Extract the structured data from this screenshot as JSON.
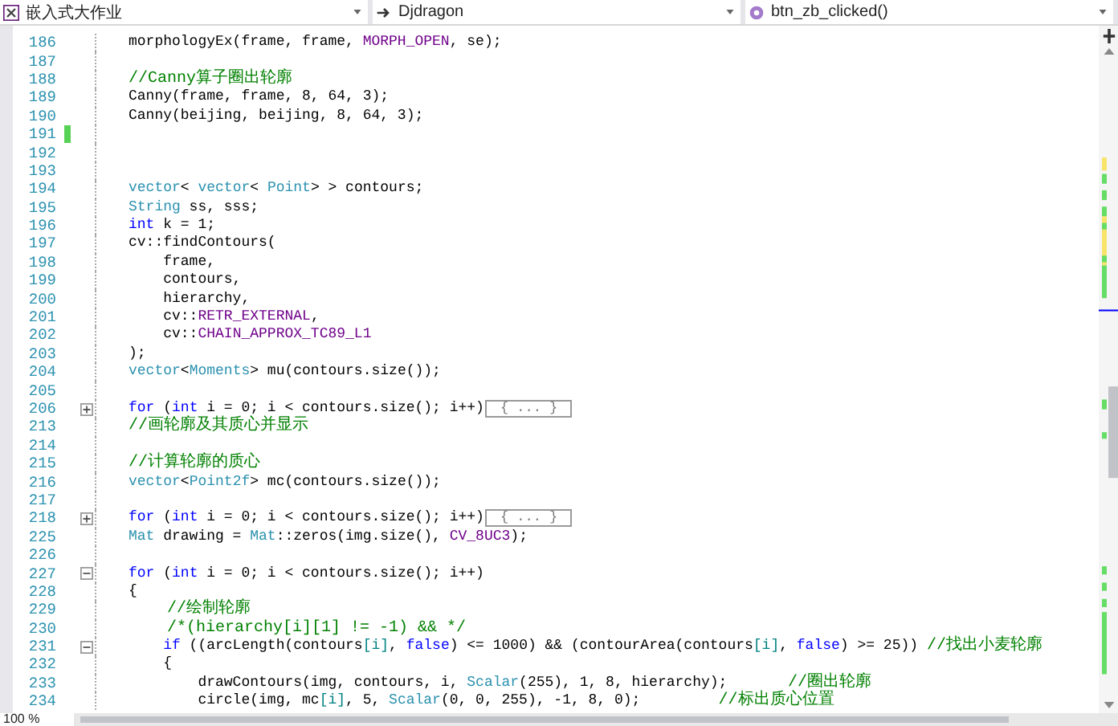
{
  "nav_bar": {
    "project": "嵌入式大作业",
    "scope": "Djdragon",
    "member": "btn_zb_clicked()"
  },
  "lines": [
    {
      "number": "186",
      "changed": false,
      "tokens": [
        {
          "text": "morphologyEx(frame, frame, ",
          "kind": "plain"
        },
        {
          "text": "MORPH_OPEN",
          "kind": "macro"
        },
        {
          "text": ", se);",
          "kind": "plain"
        }
      ]
    },
    {
      "number": "187",
      "changed": false
    },
    {
      "number": "188",
      "changed": false,
      "tokens": [
        {
          "text": "//Canny算子圈出轮廓",
          "kind": "comment"
        }
      ]
    },
    {
      "number": "189",
      "changed": false,
      "tokens": [
        {
          "text": "Canny(frame, frame, 8, 64, 3);",
          "kind": "plain"
        }
      ]
    },
    {
      "number": "190",
      "changed": false,
      "tokens": [
        {
          "text": "Canny(beijing, beijing, 8, 64, 3);",
          "kind": "plain"
        }
      ]
    },
    {
      "number": "191",
      "changed": true
    },
    {
      "number": "192",
      "changed": false
    },
    {
      "number": "193",
      "changed": false
    },
    {
      "number": "194",
      "changed": false,
      "tokens": [
        {
          "text": "vector",
          "kind": "type"
        },
        {
          "text": "< ",
          "kind": "plain"
        },
        {
          "text": "vector",
          "kind": "type"
        },
        {
          "text": "< ",
          "kind": "plain"
        },
        {
          "text": "Point",
          "kind": "type"
        },
        {
          "text": "> > contours;",
          "kind": "plain"
        }
      ]
    },
    {
      "number": "195",
      "changed": false,
      "tokens": [
        {
          "text": "String",
          "kind": "type"
        },
        {
          "text": " ss, sss;",
          "kind": "plain"
        }
      ]
    },
    {
      "number": "196",
      "changed": false,
      "tokens": [
        {
          "text": "int",
          "kind": "keyword"
        },
        {
          "text": " k = 1;",
          "kind": "plain"
        }
      ]
    },
    {
      "number": "197",
      "changed": false,
      "tokens": [
        {
          "text": "cv::findContours(",
          "kind": "plain"
        }
      ]
    },
    {
      "number": "198",
      "changed": false,
      "tokens": [
        {
          "text": "    frame,",
          "kind": "plain"
        }
      ]
    },
    {
      "number": "199",
      "changed": false,
      "tokens": [
        {
          "text": "    contours,",
          "kind": "plain"
        }
      ]
    },
    {
      "number": "200",
      "changed": false,
      "tokens": [
        {
          "text": "    hierarchy,",
          "kind": "plain"
        }
      ]
    },
    {
      "number": "201",
      "changed": false,
      "tokens": [
        {
          "text": "    cv::",
          "kind": "plain"
        },
        {
          "text": "RETR_EXTERNAL",
          "kind": "macro"
        },
        {
          "text": ",",
          "kind": "plain"
        }
      ]
    },
    {
      "number": "202",
      "changed": false,
      "tokens": [
        {
          "text": "    cv::",
          "kind": "plain"
        },
        {
          "text": "CHAIN_APPROX_TC89_L1",
          "kind": "macro"
        }
      ]
    },
    {
      "number": "203",
      "changed": false,
      "tokens": [
        {
          "text": ");",
          "kind": "plain"
        }
      ]
    },
    {
      "number": "204",
      "changed": false,
      "tokens": [
        {
          "text": "vector",
          "kind": "type"
        },
        {
          "text": "<",
          "kind": "plain"
        },
        {
          "text": "Moments",
          "kind": "type"
        },
        {
          "text": "> mu(contours.size());",
          "kind": "plain"
        }
      ]
    },
    {
      "number": "205",
      "changed": false
    },
    {
      "number": "206",
      "changed": false,
      "expanded": false,
      "collapsed": "{ ... }",
      "tokens": [
        {
          "text": "for",
          "kind": "keyword"
        },
        {
          "text": " (",
          "kind": "plain"
        },
        {
          "text": "int",
          "kind": "keyword"
        },
        {
          "text": " i = 0; i < contours.size(); i++)",
          "kind": "plain"
        }
      ]
    },
    {
      "number": "213",
      "changed": false,
      "tokens": [
        {
          "text": "//画轮廓及其质心并显示",
          "kind": "comment"
        }
      ]
    },
    {
      "number": "214",
      "changed": false
    },
    {
      "number": "215",
      "changed": false,
      "tokens": [
        {
          "text": "//计算轮廓的质心",
          "kind": "comment"
        }
      ]
    },
    {
      "number": "216",
      "changed": false,
      "tokens": [
        {
          "text": "vector",
          "kind": "type"
        },
        {
          "text": "<",
          "kind": "plain"
        },
        {
          "text": "Point2f",
          "kind": "type"
        },
        {
          "text": "> mc(contours.size());",
          "kind": "plain"
        }
      ]
    },
    {
      "number": "217",
      "changed": false
    },
    {
      "number": "218",
      "changed": false,
      "expanded": false,
      "collapsed": "{ ... }",
      "tokens": [
        {
          "text": "for",
          "kind": "keyword"
        },
        {
          "text": " (",
          "kind": "plain"
        },
        {
          "text": "int",
          "kind": "keyword"
        },
        {
          "text": " i = 0; i < contours.size(); i++)",
          "kind": "plain"
        }
      ]
    },
    {
      "number": "225",
      "changed": false,
      "tokens": [
        {
          "text": "Mat",
          "kind": "type"
        },
        {
          "text": " drawing = ",
          "kind": "plain"
        },
        {
          "text": "Mat",
          "kind": "type"
        },
        {
          "text": "::zeros(img.size(), ",
          "kind": "plain"
        },
        {
          "text": "CV_8UC3",
          "kind": "macro"
        },
        {
          "text": ");",
          "kind": "plain"
        }
      ]
    },
    {
      "number": "226",
      "changed": false
    },
    {
      "number": "227",
      "changed": false,
      "expanded": true,
      "tokens": [
        {
          "text": "for",
          "kind": "keyword"
        },
        {
          "text": " (",
          "kind": "plain"
        },
        {
          "text": "int",
          "kind": "keyword"
        },
        {
          "text": " i = 0; i < contours.size(); i++)",
          "kind": "plain"
        }
      ]
    },
    {
      "number": "228",
      "changed": false,
      "tokens": [
        {
          "text": "{",
          "kind": "plain"
        }
      ]
    },
    {
      "number": "229",
      "changed": false,
      "tokens": [
        {
          "text": "    //绘制轮廓",
          "kind": "comment"
        }
      ]
    },
    {
      "number": "230",
      "changed": false,
      "tokens": [
        {
          "text": "    /*(hierarchy[i][1] != -1) && */",
          "kind": "comment"
        }
      ]
    },
    {
      "number": "231",
      "changed": false,
      "expanded": true,
      "tokens": [
        {
          "text": "    if",
          "kind": "keyword"
        },
        {
          "text": " ((arcLength(contours",
          "kind": "plain"
        },
        {
          "text": "[i]",
          "kind": "operator"
        },
        {
          "text": ", ",
          "kind": "plain"
        },
        {
          "text": "false",
          "kind": "keyword"
        },
        {
          "text": ") <= 1000) && (contourArea(contours",
          "kind": "plain"
        },
        {
          "text": "[i]",
          "kind": "operator"
        },
        {
          "text": ", ",
          "kind": "plain"
        },
        {
          "text": "false",
          "kind": "keyword"
        },
        {
          "text": ") >= 25)) ",
          "kind": "plain"
        },
        {
          "text": "//找出小麦轮廓",
          "kind": "comment"
        }
      ]
    },
    {
      "number": "232",
      "changed": false,
      "tokens": [
        {
          "text": "    {",
          "kind": "plain"
        }
      ]
    },
    {
      "number": "233",
      "changed": false,
      "tokens": [
        {
          "text": "        drawContours(img, contours, i, ",
          "kind": "plain"
        },
        {
          "text": "Scalar",
          "kind": "type"
        },
        {
          "text": "(255), 1, 8, hierarchy);       ",
          "kind": "plain"
        },
        {
          "text": "//圈出轮廓",
          "kind": "comment"
        }
      ]
    },
    {
      "number": "234",
      "changed": false,
      "tokens": [
        {
          "text": "        circle(img, mc",
          "kind": "plain"
        },
        {
          "text": "[i]",
          "kind": "operator"
        },
        {
          "text": ", 5, ",
          "kind": "plain"
        },
        {
          "text": "Scalar",
          "kind": "type"
        },
        {
          "text": "(0, 0, 255), -1, 8, 0);         ",
          "kind": "plain"
        },
        {
          "text": "//标出质心位置",
          "kind": "comment"
        }
      ]
    }
  ],
  "zoom": "100 %"
}
